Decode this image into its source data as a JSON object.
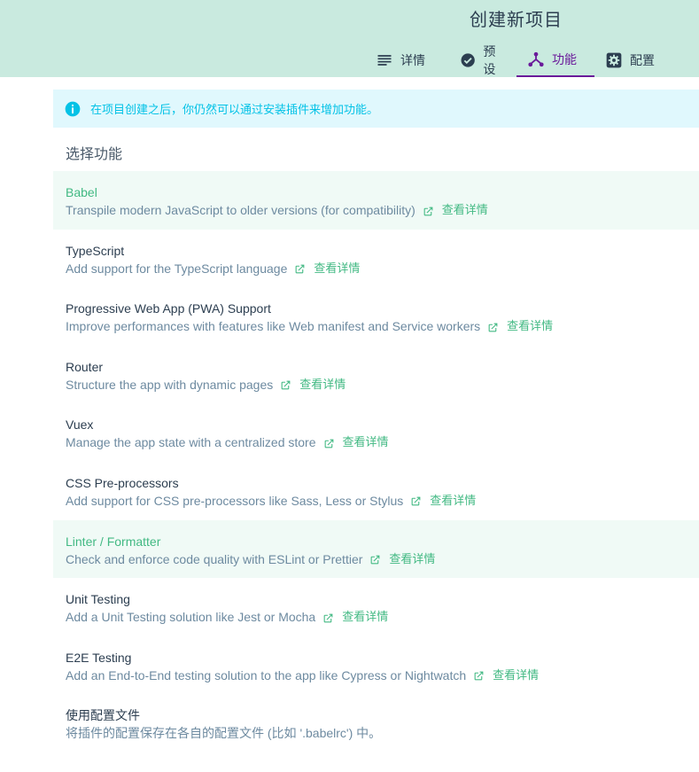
{
  "header": {
    "title": "创建新项目",
    "tabs": [
      {
        "label": "详情",
        "icon": "list-icon"
      },
      {
        "label": "预设",
        "icon": "check-circle-icon"
      },
      {
        "label": "功能",
        "icon": "tree-fork-icon",
        "active": true
      },
      {
        "label": "配置",
        "icon": "gear-box-icon"
      }
    ]
  },
  "info": {
    "text": "在项目创建之后，你仍然可以通过安装插件来增加功能。",
    "icon": "info-icon"
  },
  "section": {
    "title": "选择功能"
  },
  "link_label": "查看详情",
  "features": [
    {
      "name": "Babel",
      "desc": "Transpile modern JavaScript to older versions (for compatibility)",
      "selected": true
    },
    {
      "name": "TypeScript",
      "desc": "Add support for the TypeScript language",
      "selected": false
    },
    {
      "name": "Progressive Web App (PWA) Support",
      "desc": "Improve performances with features like Web manifest and Service workers",
      "selected": false
    },
    {
      "name": "Router",
      "desc": "Structure the app with dynamic pages",
      "selected": false
    },
    {
      "name": "Vuex",
      "desc": "Manage the app state with a centralized store",
      "selected": false
    },
    {
      "name": "CSS Pre-processors",
      "desc": "Add support for CSS pre-processors like Sass, Less or Stylus",
      "selected": false
    },
    {
      "name": "Linter / Formatter",
      "desc": "Check and enforce code quality with ESLint or Prettier",
      "selected": true
    },
    {
      "name": "Unit Testing",
      "desc": "Add a Unit Testing solution like Jest or Mocha",
      "selected": false
    },
    {
      "name": "E2E Testing",
      "desc": "Add an End-to-End testing solution to the app like Cypress or Nightwatch",
      "selected": false
    }
  ],
  "config_file": {
    "name": "使用配置文件",
    "desc": "将插件的配置保存在各自的配置文件 (比如 '.babelrc') 中。"
  },
  "colors": {
    "header_bg": "#c9eadf",
    "accent_green": "#42b983",
    "active_purple": "#6a1b9a",
    "info_cyan": "#03c2e6"
  }
}
